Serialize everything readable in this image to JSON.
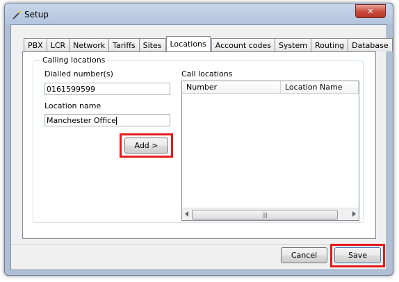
{
  "window": {
    "title": "Setup",
    "close_glyph": "✕"
  },
  "tabs": [
    "PBX",
    "LCR",
    "Network",
    "Tariffs",
    "Sites",
    "Locations",
    "Account codes",
    "System",
    "Routing",
    "Database"
  ],
  "active_tab": "Locations",
  "group": {
    "title": "Calling locations",
    "dialled_label": "Dialled number(s)",
    "dialled_value": "0161599599",
    "location_label": "Location name",
    "location_value": "Manchester Office",
    "add_button": "Add >",
    "call_locations_label": "Call locations",
    "columns": [
      "Number",
      "Location Name"
    ],
    "rows": []
  },
  "footer": {
    "cancel_button": "Cancel",
    "save_button": "Save"
  },
  "colors": {
    "highlight": "#e41b1b"
  },
  "icons": {
    "title": "wand-icon",
    "close": "close-icon"
  }
}
